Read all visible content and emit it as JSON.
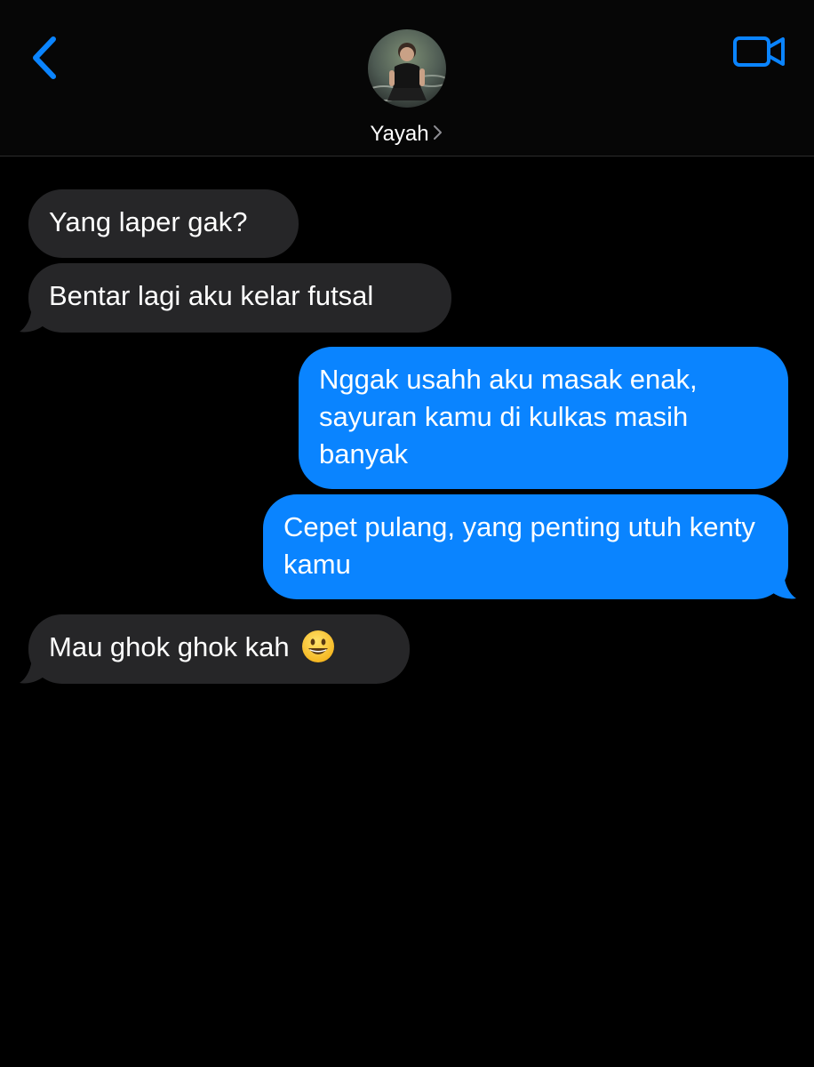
{
  "header": {
    "contact_name": "Yayah",
    "back_icon": "chevron-left-icon",
    "video_icon": "video-camera-icon",
    "accent_color": "#0a84ff"
  },
  "messages": [
    {
      "direction": "received",
      "text": "Yang laper gak?"
    },
    {
      "direction": "received",
      "text": "Bentar lagi aku kelar futsal"
    },
    {
      "direction": "sent",
      "text": "Nggak usahh aku masak enak, sayuran kamu di kulkas masih banyak"
    },
    {
      "direction": "sent",
      "text": "Cepet pulang, yang penting utuh kenty kamu"
    },
    {
      "direction": "received",
      "text": "Mau ghok ghok kah",
      "emoji": "grinning-face-icon"
    }
  ],
  "colors": {
    "background": "#000000",
    "received_bubble": "#262628",
    "sent_bubble": "#0a84ff",
    "text": "#ffffff"
  }
}
